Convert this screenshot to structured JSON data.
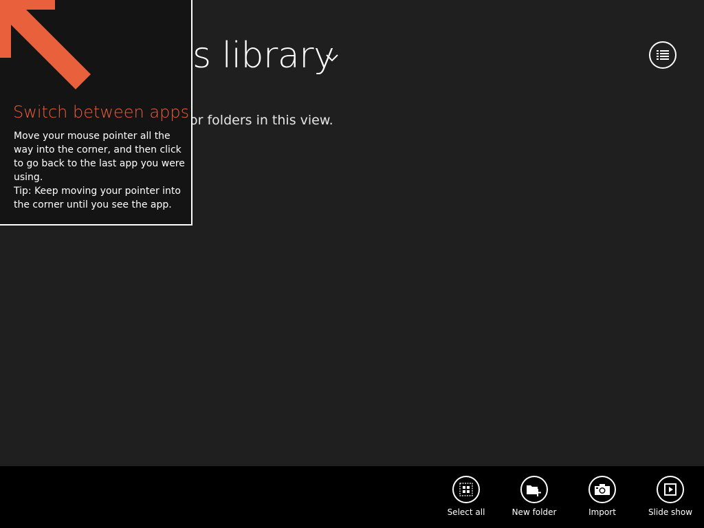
{
  "header": {
    "title_visible": "s library",
    "empty_message_visible": "or folders in this view."
  },
  "tip": {
    "title": "Switch between apps",
    "body_lines": [
      "Move your mouse pointer all the way into the corner, and then click to go back to the last app you were using.",
      "Tip: Keep moving your pointer into the corner until you see the app."
    ]
  },
  "app_bar": {
    "commands": [
      {
        "label": "Select all",
        "icon": "select-all-icon"
      },
      {
        "label": "New folder",
        "icon": "new-folder-icon"
      },
      {
        "label": "Import",
        "icon": "camera-icon"
      },
      {
        "label": "Slide show",
        "icon": "slide-show-icon"
      }
    ]
  },
  "colors": {
    "background": "#1f1f1f",
    "tip_background": "#141414",
    "accent": "#e8603c",
    "app_bar": "#000000",
    "text": "#ffffff"
  }
}
